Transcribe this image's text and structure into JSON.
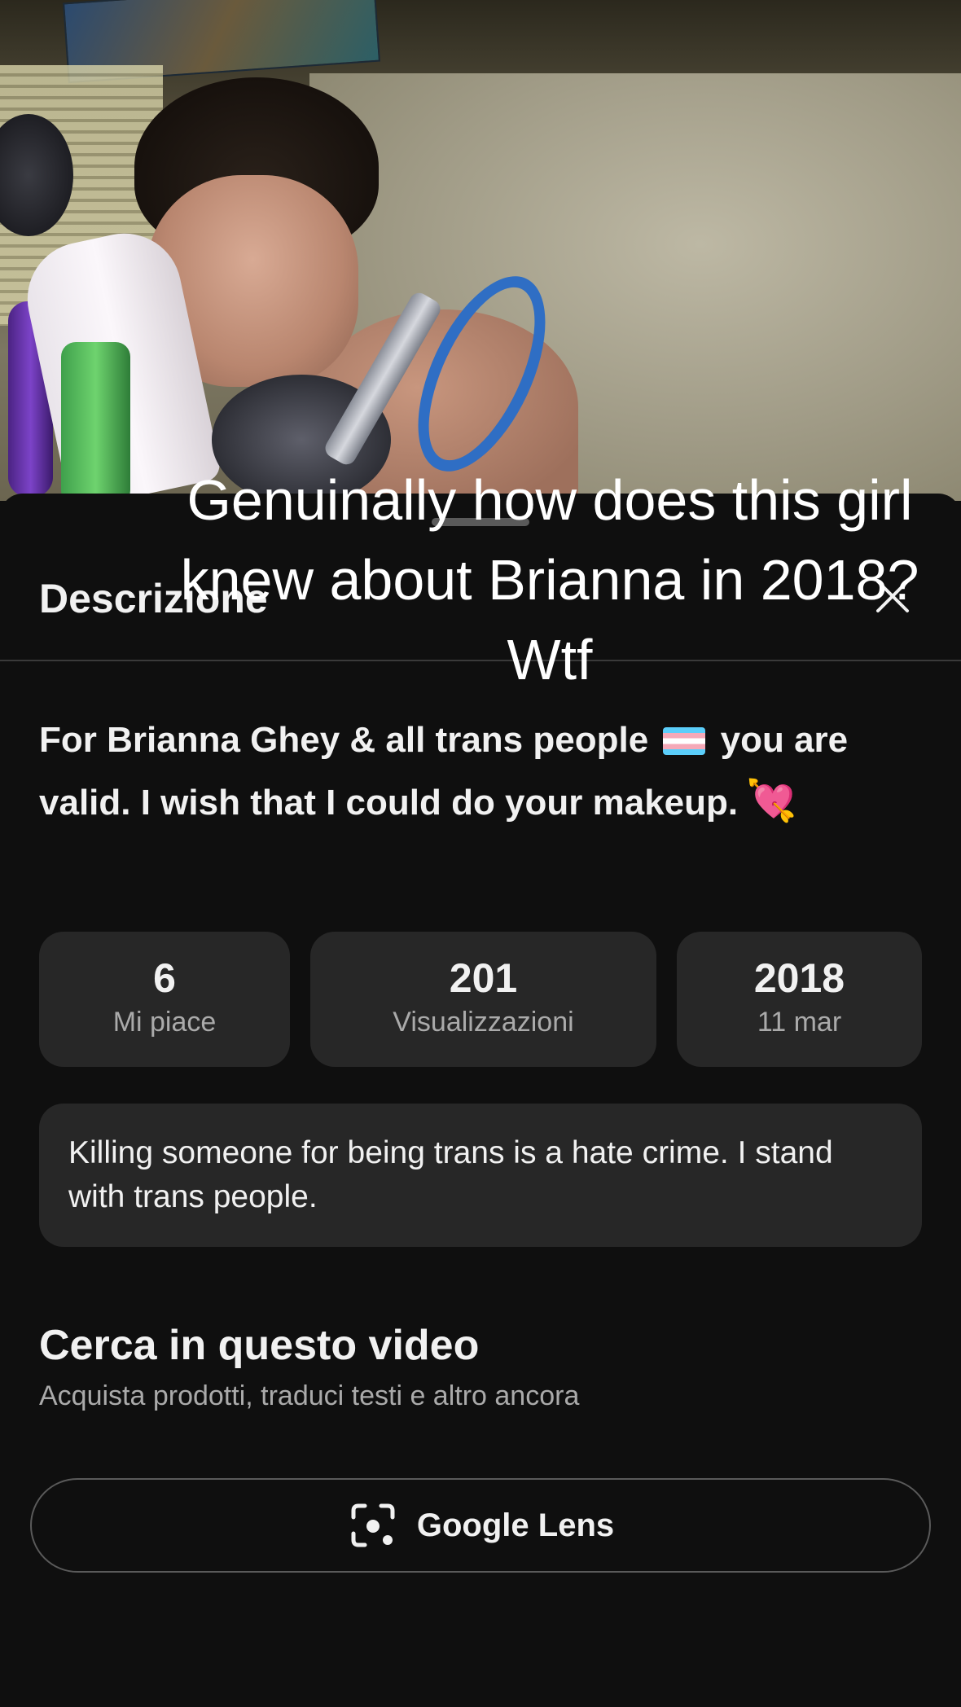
{
  "video": {
    "overlay_caption": "Genuinally how does this girl knew about Brianna in 2018? Wtf"
  },
  "sheet": {
    "title": "Descrizione",
    "close_icon": "close-icon",
    "description": {
      "line_part1": "For Brianna Ghey & all trans people",
      "flag_icon": "transgender-flag-icon",
      "line_part2": "you are valid. I wish that I could do your makeup.",
      "heart_icon": "heart-with-arrow-icon"
    },
    "stats": {
      "likes": {
        "value": "6",
        "label": "Mi piace"
      },
      "views": {
        "value": "201",
        "label": "Visualizzazioni"
      },
      "date": {
        "value": "2018",
        "label": "11 mar"
      }
    },
    "comment": "Killing someone for being trans is a hate crime. I stand with trans people.",
    "search": {
      "heading": "Cerca in questo video",
      "subtitle": "Acquista prodotti, traduci testi e altro ancora"
    },
    "lens_button": {
      "label": "Google Lens",
      "icon": "google-lens-icon"
    }
  }
}
